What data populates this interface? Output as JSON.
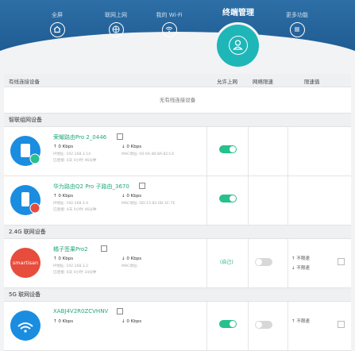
{
  "nav": {
    "items": [
      {
        "label": "全屏",
        "icon": "home-icon"
      },
      {
        "label": "联网上网",
        "icon": "globe-icon"
      },
      {
        "label": "我的 Wi-Fi",
        "icon": "wifi-icon"
      },
      {
        "label": "终端管理",
        "icon": "user-icon"
      },
      {
        "label": "更多功能",
        "icon": "menu-icon"
      }
    ]
  },
  "table_header": {
    "device_col": "有线连接设备",
    "allow_col": "允许上网",
    "limit_col": "网络限速",
    "limit_value_col": "限速值"
  },
  "wired_empty": "无有线连接设备",
  "sections": [
    {
      "title": "智联组网设备",
      "devices": [
        {
          "name": "荣耀路由Pro 2_0446",
          "up": "↑ 0 Kbps",
          "down": "↓ 0 Kbps",
          "ip": "IP地址: 192.168.3.14",
          "mac": "MAC地址: 00:0A:4B:8A:82:C4",
          "time": "已连接: 4天 0小时 46分钟",
          "allow": true,
          "color": "#1a8de0"
        },
        {
          "name": "华为路由Q2 Pro 子路由_3670",
          "up": "↑ 0 Kbps",
          "down": "↓ 0 Kbps",
          "ip": "IP地址: 192.168.3.4",
          "mac": "MAC地址: DD:15:82:0D:3C:7E",
          "time": "已连接: 4天 0小时 46分钟",
          "allow": true,
          "color": "#1a8de0"
        }
      ]
    },
    {
      "title": "2.4G 联网设备",
      "devices": [
        {
          "name": "橘子签果Pro2",
          "up": "↑ 0 Kbps",
          "down": "↓ 0 Kbps",
          "ip": "IP地址: 192.168.3.2",
          "mac": "MAC地址: ",
          "time": "已连接: 6天 0小时 34分钟",
          "allow": false,
          "self": "(自己)",
          "limit_up": "↑ 不限速",
          "limit_down": "↓ 不限速",
          "avatar_text": "smartisan",
          "color": "#e74c3c"
        }
      ]
    },
    {
      "title": "5G 联网设备",
      "devices": [
        {
          "name": "XABJ4V2R0ZCVHNV",
          "up": "↑ 0 Kbps",
          "down": "↓ 0 Kbps",
          "allow": true,
          "limit_up": "↑ 不限速",
          "color": "#1a8de0"
        }
      ]
    }
  ]
}
